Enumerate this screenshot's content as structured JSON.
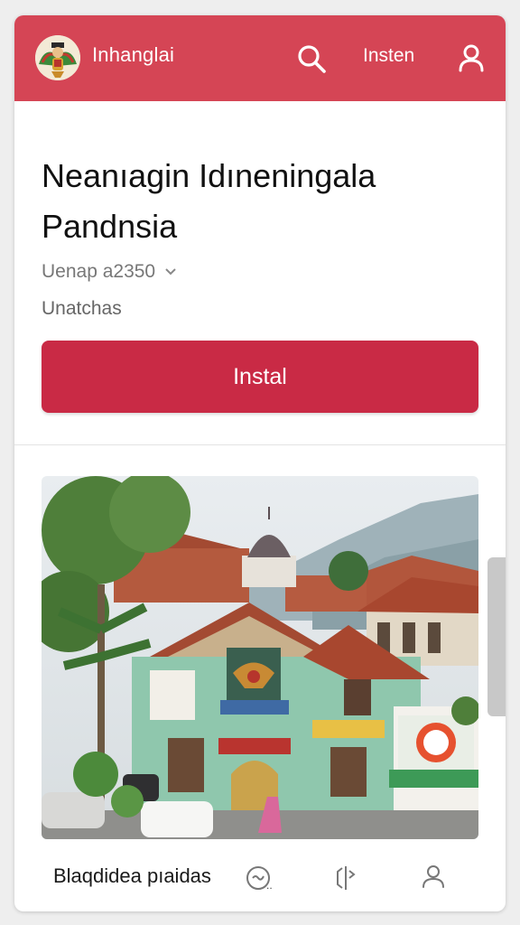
{
  "header": {
    "app_name": "Inhanglai",
    "install_link": "Insten",
    "logo": "garuda-logo-icon",
    "search_icon": "search-icon",
    "user_icon": "user-icon"
  },
  "main": {
    "title": "Neanıagin Idıneningala Pandnsia",
    "version": "Uenap a2350",
    "subtext": "Unatchas",
    "install_button": "Instal"
  },
  "bottom_bar": {
    "label": "Blaqdidea pıaidas",
    "icons": [
      "tag-icon",
      "share-icon",
      "user-icon"
    ]
  },
  "colors": {
    "header": "#d54555",
    "button": "#c92a45",
    "text": "#111111",
    "muted": "#777777"
  }
}
